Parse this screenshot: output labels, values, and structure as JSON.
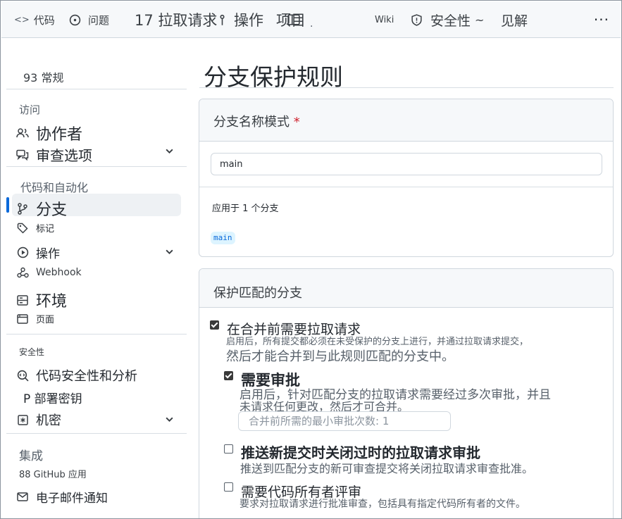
{
  "nav": {
    "items": [
      {
        "icon": "code-icon",
        "label": "代码"
      },
      {
        "icon": "issue-icon",
        "label": "问题"
      },
      {
        "label": "17 拉取请求"
      },
      {
        "label": "操作"
      },
      {
        "label": "项目"
      },
      {
        "label": "Wiki"
      },
      {
        "icon": "shield-icon",
        "label": "安全性"
      },
      {
        "label": "见解"
      }
    ],
    "more_label": "···"
  },
  "sidebar": {
    "general_label": "93 常规",
    "access_heading": "访问",
    "collaborators_label": "协作者",
    "moderation_label": "审查选项",
    "code_automation_heading": "代码和自动化",
    "branches_label": "分支",
    "tags_label": "标记",
    "actions_label": "操作",
    "webhook_label": "Webhook",
    "environments_label": "环境",
    "pages_label": "页面",
    "security_heading": "安全性",
    "code_security_label": "代码安全性和分析",
    "deploy_keys_label": "P 部署密钥",
    "secrets_label": "机密",
    "integrations_heading": "集成",
    "github_apps_label": "88  GitHub 应用",
    "email_label": "电子邮件通知"
  },
  "main": {
    "title": "分支保护规则",
    "pattern_label": "分支名称模式",
    "required_mark": "*",
    "pattern_value": "main",
    "applies_text": "应用于 1 个分支",
    "branch_pill": "main",
    "protect_heading": "保护匹配的分支",
    "require_pr": {
      "checked": true,
      "title": "在合并前需要拉取请求",
      "desc1": "启用后，所有提交都必须在未受保护的分支上进行，并通过拉取请求提交，",
      "desc2": "然后才能合并到与此规则匹配的分支中。"
    },
    "require_approvals": {
      "checked": true,
      "title": "需要审批",
      "desc1": "启用后，针对匹配分支的拉取请求需要经过多次审批，并且",
      "desc2": "未请求任何更改，然后才可合并。",
      "count_label": "合并前所需的最小审批次数: 1"
    },
    "dismiss_stale": {
      "checked": false,
      "title": "推送新提交时关闭过时的拉取请求审批",
      "desc1": "推送到匹配分支的新可审查提交将关闭拉取请求审查批准。"
    },
    "code_owners": {
      "checked": false,
      "title": "需要代码所有者评审",
      "desc1": "要求对拉取请求进行批准审查，包括具有指定代码所有者的文件。"
    }
  }
}
